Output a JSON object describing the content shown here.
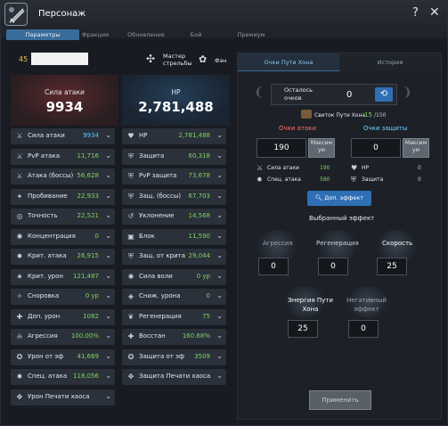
{
  "window": {
    "title": "Персонаж",
    "help": "?",
    "close": "✕"
  },
  "tabs": [
    "Параметры",
    "Фракция",
    "Обновление",
    "Бой",
    "Премиум"
  ],
  "user": {
    "level": "45",
    "spec1": "Мастер\nстрельбы",
    "spec2": "Фэн"
  },
  "big": {
    "attack_label": "Сила атаки",
    "attack_value": "9934",
    "hp_label": "HP",
    "hp_value": "2,781,488"
  },
  "left_stats": [
    {
      "icon": "swords-icon",
      "glyph": "⚔",
      "label": "Сила атаки",
      "value": "9934",
      "hi": true
    },
    {
      "icon": "pvp-icon",
      "glyph": "⚔",
      "label": "PvP атака",
      "value": "11,716",
      "hi": false
    },
    {
      "icon": "boss-attack-icon",
      "glyph": "⚔",
      "label": "Атака (боссы)",
      "value": "56,628",
      "hi": false
    },
    {
      "icon": "pierce-icon",
      "glyph": "✦",
      "label": "Пробивание",
      "value": "22,933",
      "hi": false
    },
    {
      "icon": "accuracy-icon",
      "glyph": "◎",
      "label": "Точность",
      "value": "22,521",
      "hi": false
    },
    {
      "icon": "concentration-icon",
      "glyph": "✺",
      "label": "Концентрация",
      "value": "0",
      "hi": false
    },
    {
      "icon": "crit-icon",
      "glyph": "✸",
      "label": "Крит. атака",
      "value": "26,915",
      "hi": false
    },
    {
      "icon": "crit-damage-icon",
      "glyph": "✷",
      "label": "Крит. урон",
      "value": "121,487",
      "hi": false
    },
    {
      "icon": "agility-icon",
      "glyph": "✧",
      "label": "Сноровка",
      "value": "0 ур",
      "hi": false
    },
    {
      "icon": "add-damage-icon",
      "glyph": "✚",
      "label": "Доп. урон",
      "value": "1082",
      "hi": false
    },
    {
      "icon": "aggression-icon",
      "glyph": "☠",
      "label": "Агрессия",
      "value": "100.00%",
      "hi": false
    },
    {
      "icon": "element-damage-icon",
      "glyph": "✪",
      "label": "Урон от эф",
      "value": "41,669",
      "hi": false
    },
    {
      "icon": "special-attack-icon",
      "glyph": "✹",
      "label": "Спец. атака",
      "value": "118,056",
      "hi": false
    },
    {
      "icon": "chaos-seal-icon",
      "glyph": "✥",
      "label": "Урон Печати хаоса",
      "value": "",
      "hi": false
    }
  ],
  "right_stats": [
    {
      "icon": "heart-icon",
      "glyph": "♥",
      "label": "HP",
      "value": "2,781,488",
      "hi": false
    },
    {
      "icon": "shield-icon",
      "glyph": "⛨",
      "label": "Защита",
      "value": "60,318",
      "hi": false
    },
    {
      "icon": "pvp-defense-icon",
      "glyph": "⛨",
      "label": "PvP защита",
      "value": "73,678",
      "hi": false
    },
    {
      "icon": "boss-defense-icon",
      "glyph": "⛨",
      "label": "Защ. (боссы)",
      "value": "67,703",
      "hi": false
    },
    {
      "icon": "evasion-icon",
      "glyph": "↺",
      "label": "Уклонение",
      "value": "14,568",
      "hi": false
    },
    {
      "icon": "block-icon",
      "glyph": "▣",
      "label": "Блок",
      "value": "11,590",
      "hi": false
    },
    {
      "icon": "crit-defense-icon",
      "glyph": "⛨",
      "label": "Защ. от крита",
      "value": "29,044",
      "hi": false
    },
    {
      "icon": "willpower-icon",
      "glyph": "✺",
      "label": "Сила воли",
      "value": "0 ур",
      "hi": false
    },
    {
      "icon": "damage-reduce-icon",
      "glyph": "◈",
      "label": "Сниж. урона",
      "value": "0",
      "hi": false
    },
    {
      "icon": "regen-icon",
      "glyph": "❦",
      "label": "Регенерация",
      "value": "75",
      "hi": false
    },
    {
      "icon": "recovery-icon",
      "glyph": "✚",
      "label": "Восстан",
      "value": "160.68%",
      "hi": false
    },
    {
      "icon": "element-defense-icon",
      "glyph": "✪",
      "label": "Защита от эф",
      "value": "3509",
      "hi": false
    },
    {
      "icon": "chaos-seal-defense-icon",
      "glyph": "✥",
      "label": "Защита Печати хаоса",
      "value": "",
      "hi": false
    }
  ],
  "hong": {
    "tab_active": "Очки Пути Хона",
    "tab_history": "История",
    "remaining_label": "Осталось\nочков",
    "remaining_value": "0",
    "scroll_label": "Свиток Пути Хона",
    "scroll_cur": "15",
    "scroll_max": "/150",
    "atk_points_title": "Очки атаки",
    "def_points_title": "Очки защиты",
    "atk_input": "190",
    "def_input": "0",
    "max_label": "Максим\nум",
    "atk_lines": [
      {
        "label": "Сила атаки",
        "value": "190"
      },
      {
        "label": "Спец. атака",
        "value": "580"
      }
    ],
    "def_lines": [
      {
        "label": "HP",
        "value": "0"
      },
      {
        "label": "Защита",
        "value": "0"
      }
    ],
    "extra_effect": "Доп. эффект",
    "chosen_effect": "Выбранный эффект",
    "effects": [
      {
        "label": "Агрессия",
        "value": "0"
      },
      {
        "label": "Регенерация",
        "value": "0"
      },
      {
        "label": "Скорость",
        "value": "25"
      }
    ],
    "energy": [
      {
        "label": "Энергия Пути\nХона",
        "value": "25"
      },
      {
        "label": "Негативный\nэффект",
        "value": "0"
      }
    ],
    "apply": "Применить"
  },
  "colors": {
    "accent": "#2e6fb6",
    "green": "#7fd65a",
    "blue_value": "#55c8ff",
    "red_title": "#ff6b6b",
    "cyan_title": "#6fd3ff"
  }
}
